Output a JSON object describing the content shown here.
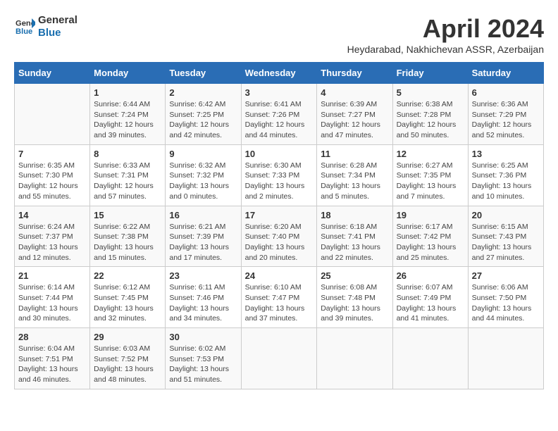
{
  "logo": {
    "line1": "General",
    "line2": "Blue"
  },
  "title": "April 2024",
  "location": "Heydarabad, Nakhichevan ASSR, Azerbaijan",
  "weekdays": [
    "Sunday",
    "Monday",
    "Tuesday",
    "Wednesday",
    "Thursday",
    "Friday",
    "Saturday"
  ],
  "weeks": [
    [
      {
        "day": "",
        "content": ""
      },
      {
        "day": "1",
        "content": "Sunrise: 6:44 AM\nSunset: 7:24 PM\nDaylight: 12 hours\nand 39 minutes."
      },
      {
        "day": "2",
        "content": "Sunrise: 6:42 AM\nSunset: 7:25 PM\nDaylight: 12 hours\nand 42 minutes."
      },
      {
        "day": "3",
        "content": "Sunrise: 6:41 AM\nSunset: 7:26 PM\nDaylight: 12 hours\nand 44 minutes."
      },
      {
        "day": "4",
        "content": "Sunrise: 6:39 AM\nSunset: 7:27 PM\nDaylight: 12 hours\nand 47 minutes."
      },
      {
        "day": "5",
        "content": "Sunrise: 6:38 AM\nSunset: 7:28 PM\nDaylight: 12 hours\nand 50 minutes."
      },
      {
        "day": "6",
        "content": "Sunrise: 6:36 AM\nSunset: 7:29 PM\nDaylight: 12 hours\nand 52 minutes."
      }
    ],
    [
      {
        "day": "7",
        "content": "Sunrise: 6:35 AM\nSunset: 7:30 PM\nDaylight: 12 hours\nand 55 minutes."
      },
      {
        "day": "8",
        "content": "Sunrise: 6:33 AM\nSunset: 7:31 PM\nDaylight: 12 hours\nand 57 minutes."
      },
      {
        "day": "9",
        "content": "Sunrise: 6:32 AM\nSunset: 7:32 PM\nDaylight: 13 hours\nand 0 minutes."
      },
      {
        "day": "10",
        "content": "Sunrise: 6:30 AM\nSunset: 7:33 PM\nDaylight: 13 hours\nand 2 minutes."
      },
      {
        "day": "11",
        "content": "Sunrise: 6:28 AM\nSunset: 7:34 PM\nDaylight: 13 hours\nand 5 minutes."
      },
      {
        "day": "12",
        "content": "Sunrise: 6:27 AM\nSunset: 7:35 PM\nDaylight: 13 hours\nand 7 minutes."
      },
      {
        "day": "13",
        "content": "Sunrise: 6:25 AM\nSunset: 7:36 PM\nDaylight: 13 hours\nand 10 minutes."
      }
    ],
    [
      {
        "day": "14",
        "content": "Sunrise: 6:24 AM\nSunset: 7:37 PM\nDaylight: 13 hours\nand 12 minutes."
      },
      {
        "day": "15",
        "content": "Sunrise: 6:22 AM\nSunset: 7:38 PM\nDaylight: 13 hours\nand 15 minutes."
      },
      {
        "day": "16",
        "content": "Sunrise: 6:21 AM\nSunset: 7:39 PM\nDaylight: 13 hours\nand 17 minutes."
      },
      {
        "day": "17",
        "content": "Sunrise: 6:20 AM\nSunset: 7:40 PM\nDaylight: 13 hours\nand 20 minutes."
      },
      {
        "day": "18",
        "content": "Sunrise: 6:18 AM\nSunset: 7:41 PM\nDaylight: 13 hours\nand 22 minutes."
      },
      {
        "day": "19",
        "content": "Sunrise: 6:17 AM\nSunset: 7:42 PM\nDaylight: 13 hours\nand 25 minutes."
      },
      {
        "day": "20",
        "content": "Sunrise: 6:15 AM\nSunset: 7:43 PM\nDaylight: 13 hours\nand 27 minutes."
      }
    ],
    [
      {
        "day": "21",
        "content": "Sunrise: 6:14 AM\nSunset: 7:44 PM\nDaylight: 13 hours\nand 30 minutes."
      },
      {
        "day": "22",
        "content": "Sunrise: 6:12 AM\nSunset: 7:45 PM\nDaylight: 13 hours\nand 32 minutes."
      },
      {
        "day": "23",
        "content": "Sunrise: 6:11 AM\nSunset: 7:46 PM\nDaylight: 13 hours\nand 34 minutes."
      },
      {
        "day": "24",
        "content": "Sunrise: 6:10 AM\nSunset: 7:47 PM\nDaylight: 13 hours\nand 37 minutes."
      },
      {
        "day": "25",
        "content": "Sunrise: 6:08 AM\nSunset: 7:48 PM\nDaylight: 13 hours\nand 39 minutes."
      },
      {
        "day": "26",
        "content": "Sunrise: 6:07 AM\nSunset: 7:49 PM\nDaylight: 13 hours\nand 41 minutes."
      },
      {
        "day": "27",
        "content": "Sunrise: 6:06 AM\nSunset: 7:50 PM\nDaylight: 13 hours\nand 44 minutes."
      }
    ],
    [
      {
        "day": "28",
        "content": "Sunrise: 6:04 AM\nSunset: 7:51 PM\nDaylight: 13 hours\nand 46 minutes."
      },
      {
        "day": "29",
        "content": "Sunrise: 6:03 AM\nSunset: 7:52 PM\nDaylight: 13 hours\nand 48 minutes."
      },
      {
        "day": "30",
        "content": "Sunrise: 6:02 AM\nSunset: 7:53 PM\nDaylight: 13 hours\nand 51 minutes."
      },
      {
        "day": "",
        "content": ""
      },
      {
        "day": "",
        "content": ""
      },
      {
        "day": "",
        "content": ""
      },
      {
        "day": "",
        "content": ""
      }
    ]
  ]
}
